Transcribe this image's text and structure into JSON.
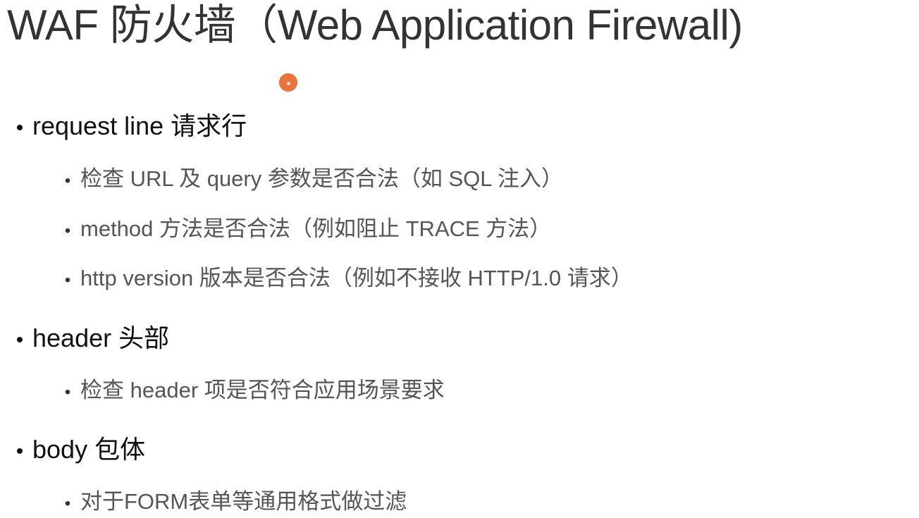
{
  "title": "WAF 防火墙（Web Application Firewall)",
  "accent_color": "#e8743b",
  "bullet_char": "•",
  "sections": [
    {
      "label": "request line 请求行",
      "items": [
        "检查 URL 及 query 参数是否合法（如 SQL 注入）",
        "method 方法是否合法（例如阻止 TRACE 方法）",
        "http version 版本是否合法（例如不接收 HTTP/1.0 请求）"
      ]
    },
    {
      "label": "header 头部",
      "items": [
        "检查 header 项是否符合应用场景要求"
      ]
    },
    {
      "label": "body 包体",
      "items": [
        "对于FORM表单等通用格式做过滤"
      ]
    }
  ]
}
